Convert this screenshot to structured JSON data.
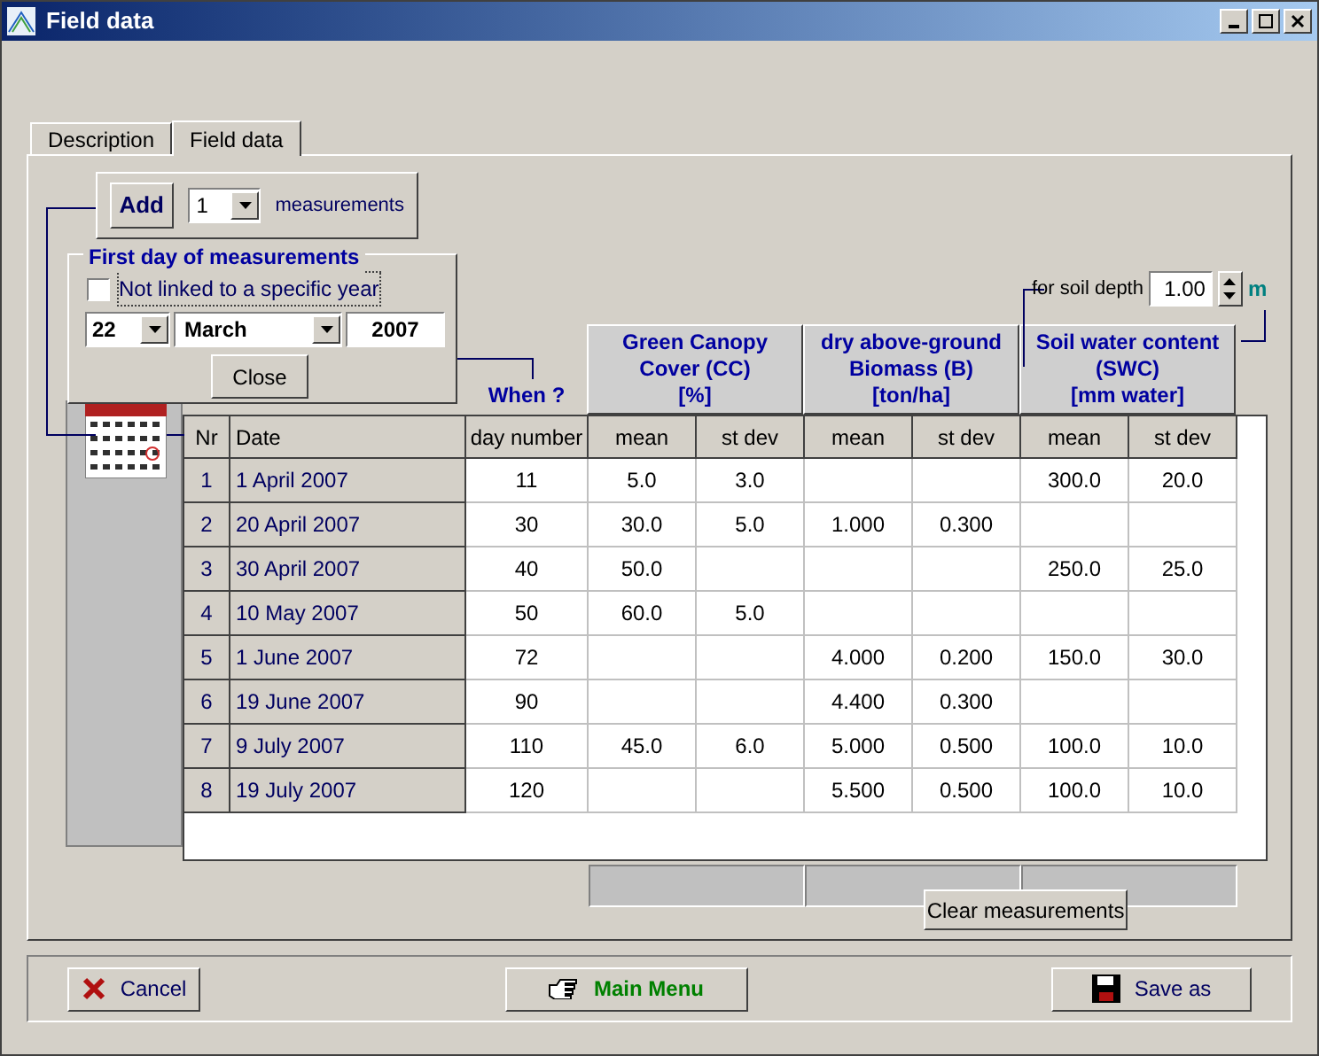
{
  "window": {
    "title": "Field data"
  },
  "tabs": [
    {
      "label": "Description",
      "selected": false
    },
    {
      "label": "Field data",
      "selected": true
    }
  ],
  "add_panel": {
    "button": "Add",
    "count": "1",
    "label": "measurements"
  },
  "first_day": {
    "title": "First day of measurements",
    "not_linked": {
      "label": "Not linked to a specific year",
      "checked": false
    },
    "day": "22",
    "month": "March",
    "year": "2007",
    "close": "Close"
  },
  "soil_depth": {
    "label": "for soil depth",
    "value": "1.00",
    "unit": "m"
  },
  "table": {
    "when": "When ?",
    "groups": [
      [
        "Green Canopy",
        "Cover (CC)",
        "[%]"
      ],
      [
        "dry above-ground",
        "Biomass (B)",
        "[ton/ha]"
      ],
      [
        "Soil water content",
        "(SWC)",
        "[mm water]"
      ]
    ],
    "columns": [
      "Nr",
      "Date",
      "day number",
      "mean",
      "st dev",
      "mean",
      "st dev",
      "mean",
      "st dev"
    ],
    "rows": [
      {
        "nr": "1",
        "date": "1 April 2007",
        "day": "11",
        "cc_mean": "5.0",
        "cc_sd": "3.0",
        "swc_mean": "300.0",
        "swc_sd": "20.0"
      },
      {
        "nr": "2",
        "date": "20 April 2007",
        "day": "30",
        "cc_mean": "30.0",
        "cc_sd": "5.0",
        "b_mean": "1.000",
        "b_sd": "0.300"
      },
      {
        "nr": "3",
        "date": "30 April 2007",
        "day": "40",
        "cc_mean": "50.0",
        "swc_mean": "250.0",
        "swc_sd": "25.0"
      },
      {
        "nr": "4",
        "date": "10 May 2007",
        "day": "50",
        "cc_mean": "60.0",
        "cc_sd": "5.0"
      },
      {
        "nr": "5",
        "date": "1 June 2007",
        "day": "72",
        "b_mean": "4.000",
        "b_sd": "0.200",
        "swc_mean": "150.0",
        "swc_sd": "30.0"
      },
      {
        "nr": "6",
        "date": "19 June 2007",
        "day": "90",
        "b_mean": "4.400",
        "b_sd": "0.300"
      },
      {
        "nr": "7",
        "date": "9 July 2007",
        "day": "110",
        "cc_mean": "45.0",
        "cc_sd": "6.0",
        "b_mean": "5.000",
        "b_sd": "0.500",
        "swc_mean": "100.0",
        "swc_sd": "10.0"
      },
      {
        "nr": "8",
        "date": "19 July 2007",
        "day": "120",
        "b_mean": "5.500",
        "b_sd": "0.500",
        "swc_mean": "100.0",
        "swc_sd": "10.0"
      }
    ]
  },
  "clear_button": "Clear measurements",
  "buttons": [
    {
      "label": "Cancel",
      "kind": "cancel"
    },
    {
      "label": "Main Menu",
      "kind": "menu"
    },
    {
      "label": "Save as",
      "kind": "save"
    }
  ]
}
